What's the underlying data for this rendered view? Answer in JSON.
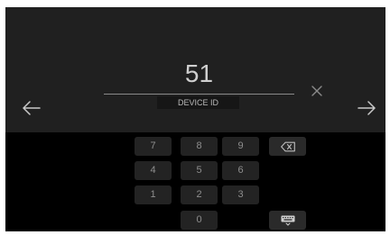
{
  "entry": {
    "value": "51",
    "label": "DEVICE ID"
  },
  "icons": {
    "back": "arrow-left-icon",
    "next": "arrow-right-icon",
    "clear": "close-icon",
    "backspace": "backspace-icon",
    "keyboard": "keyboard-hide-icon"
  },
  "keypad": {
    "row1": [
      "7",
      "8",
      "9"
    ],
    "row2": [
      "4",
      "5",
      "6"
    ],
    "row3": [
      "1",
      "2",
      "3"
    ],
    "row4": [
      "0"
    ]
  },
  "colors": {
    "screen": "#000000",
    "entry_panel": "#202020",
    "key": "#232323",
    "key_text": "#8e8e8e",
    "value_text": "#cfcfcf"
  }
}
